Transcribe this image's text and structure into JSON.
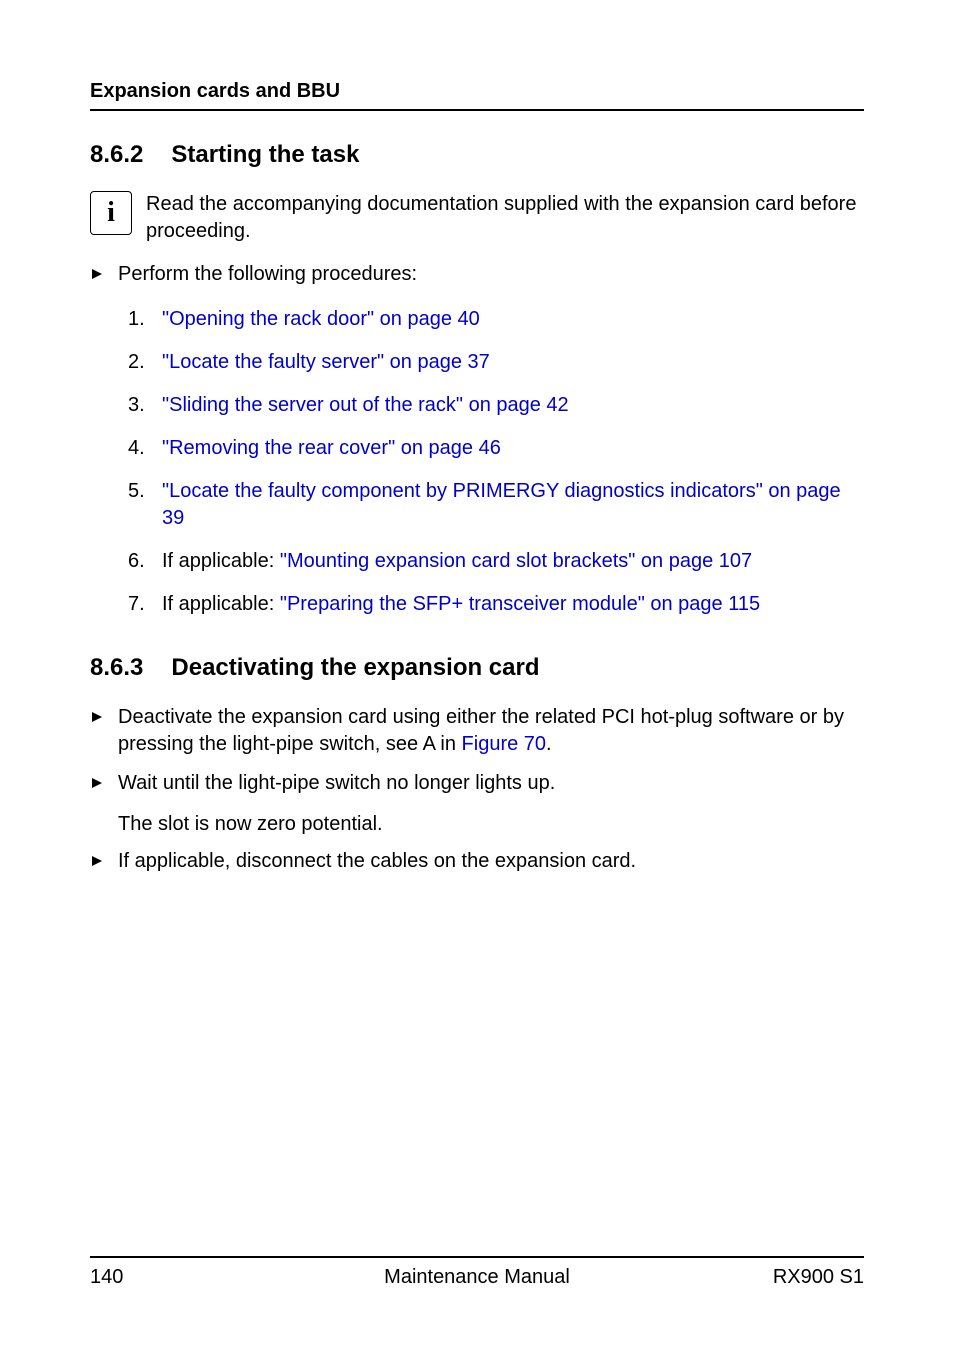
{
  "running_header": "Expansion cards and BBU",
  "section1": {
    "number": "8.6.2",
    "title": "Starting the task"
  },
  "info_note": "Read the accompanying documentation supplied with the expansion card before proceeding.",
  "perform_intro": "Perform the following procedures:",
  "steps": [
    {
      "n": "1.",
      "prefix": "",
      "link": "\"Opening the rack door\" on page 40",
      "suffix": ""
    },
    {
      "n": "2.",
      "prefix": "",
      "link": "\"Locate the faulty server\" on page 37",
      "suffix": ""
    },
    {
      "n": "3.",
      "prefix": "",
      "link": "\"Sliding the server out of the rack\" on page 42",
      "suffix": ""
    },
    {
      "n": "4.",
      "prefix": "",
      "link": "\"Removing the rear cover\" on page 46",
      "suffix": ""
    },
    {
      "n": "5.",
      "prefix": "",
      "link": "\"Locate the faulty component by PRIMERGY diagnostics indicators\" on page 39",
      "suffix": ""
    },
    {
      "n": "6.",
      "prefix": "If applicable: ",
      "link": "\"Mounting expansion card slot brackets\" on page 107",
      "suffix": ""
    },
    {
      "n": "7.",
      "prefix": "If applicable: ",
      "link": "\"Preparing the SFP+ transceiver module\" on page 115",
      "suffix": ""
    }
  ],
  "section2": {
    "number": "8.6.3",
    "title": "Deactivating the expansion card"
  },
  "bullets2": [
    {
      "pre": "Deactivate the expansion card using either the related PCI hot-plug software or by pressing the light-pipe switch, see A in ",
      "link": "Figure 70",
      "post": "."
    },
    {
      "pre": "Wait until the light-pipe switch no longer lights up.",
      "link": "",
      "post": ""
    }
  ],
  "slot_zero": "The slot is now zero potential.",
  "bullet3": "If applicable, disconnect the cables on the expansion card.",
  "footer": {
    "page": "140",
    "center": "Maintenance Manual",
    "right": "RX900 S1"
  }
}
